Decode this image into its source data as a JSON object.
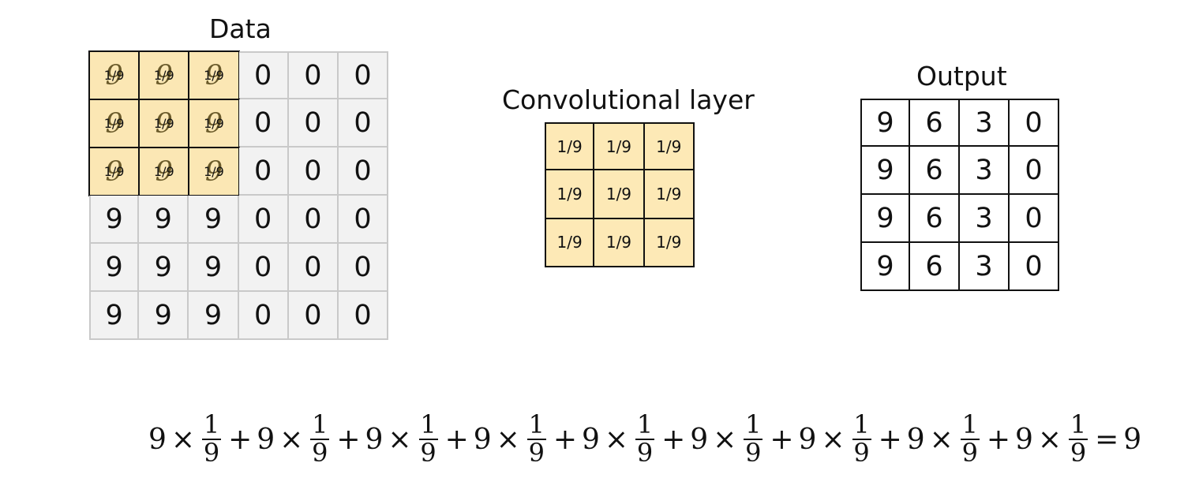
{
  "data_panel": {
    "title": "Data",
    "rows": [
      [
        "9",
        "9",
        "9",
        "0",
        "0",
        "0"
      ],
      [
        "9",
        "9",
        "9",
        "0",
        "0",
        "0"
      ],
      [
        "9",
        "9",
        "9",
        "0",
        "0",
        "0"
      ],
      [
        "9",
        "9",
        "9",
        "0",
        "0",
        "0"
      ],
      [
        "9",
        "9",
        "9",
        "0",
        "0",
        "0"
      ],
      [
        "9",
        "9",
        "9",
        "0",
        "0",
        "0"
      ]
    ],
    "highlight": {
      "rows": 3,
      "cols": 3,
      "weight_label": "1/9"
    }
  },
  "kernel_panel": {
    "title": "Convolutional layer",
    "rows": [
      [
        "1/9",
        "1/9",
        "1/9"
      ],
      [
        "1/9",
        "1/9",
        "1/9"
      ],
      [
        "1/9",
        "1/9",
        "1/9"
      ]
    ]
  },
  "output_panel": {
    "title": "Output",
    "rows": [
      [
        "9",
        "6",
        "3",
        "0"
      ],
      [
        "9",
        "6",
        "3",
        "0"
      ],
      [
        "9",
        "6",
        "3",
        "0"
      ],
      [
        "9",
        "6",
        "3",
        "0"
      ]
    ]
  },
  "equation": {
    "term": {
      "value": "9",
      "times": "×",
      "numerator": "1",
      "denominator": "9"
    },
    "plus": "+",
    "term_count": 9,
    "equals": "=",
    "result": "9"
  },
  "colors": {
    "highlight_fill": "#fbe7b4",
    "kernel_fill": "#fde9b6",
    "data_fill": "#f2f2f2",
    "data_border": "#c9c9c9",
    "border": "#111111"
  }
}
